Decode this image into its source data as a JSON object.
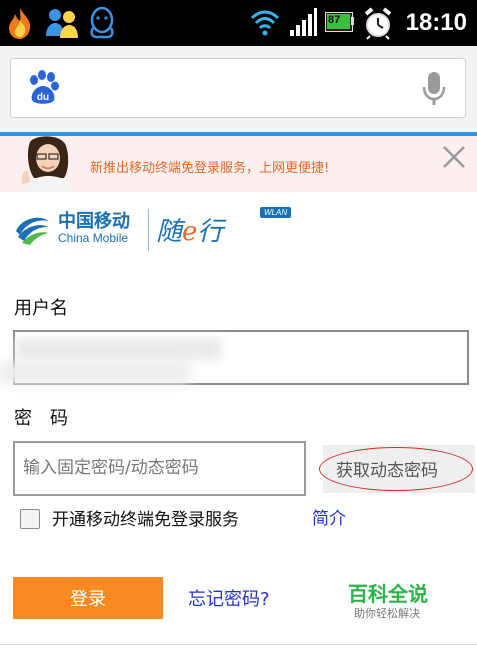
{
  "status_bar": {
    "time": "18:10",
    "battery_level": "87"
  },
  "search": {
    "placeholder": ""
  },
  "banner": {
    "text": "新推出移动终端免登录服务，上网更便捷!"
  },
  "logo": {
    "company_cn": "中国移动",
    "company_en": "China Mobile",
    "service_pre": "随",
    "service_e": "e",
    "service_post": "行",
    "badge": "WLAN"
  },
  "form": {
    "username_label": "用户名",
    "username_value": "",
    "password_label": "密　码",
    "password_placeholder": "输入固定密码/动态密码",
    "get_dynamic_password": "获取动态密码",
    "auto_login_label": "开通移动终端免登录服务",
    "intro_link": "简介",
    "login_button": "登录",
    "forgot_password": "忘记密码?"
  },
  "watermark": {
    "title": "百科全说",
    "subtitle": "助你轻松解决"
  },
  "colors": {
    "accent_blue": "#2a95e6",
    "login_orange": "#f88a24",
    "link_blue": "#2233cc",
    "banner_orange": "#e0692a",
    "baike_green": "#2cb34a"
  },
  "icons": [
    "flame-icon",
    "people-icon",
    "qq-icon",
    "wifi-icon",
    "signal-icon",
    "battery-icon",
    "alarm-icon",
    "baidu-paw-icon",
    "microphone-icon",
    "close-icon",
    "china-mobile-logo-icon"
  ]
}
